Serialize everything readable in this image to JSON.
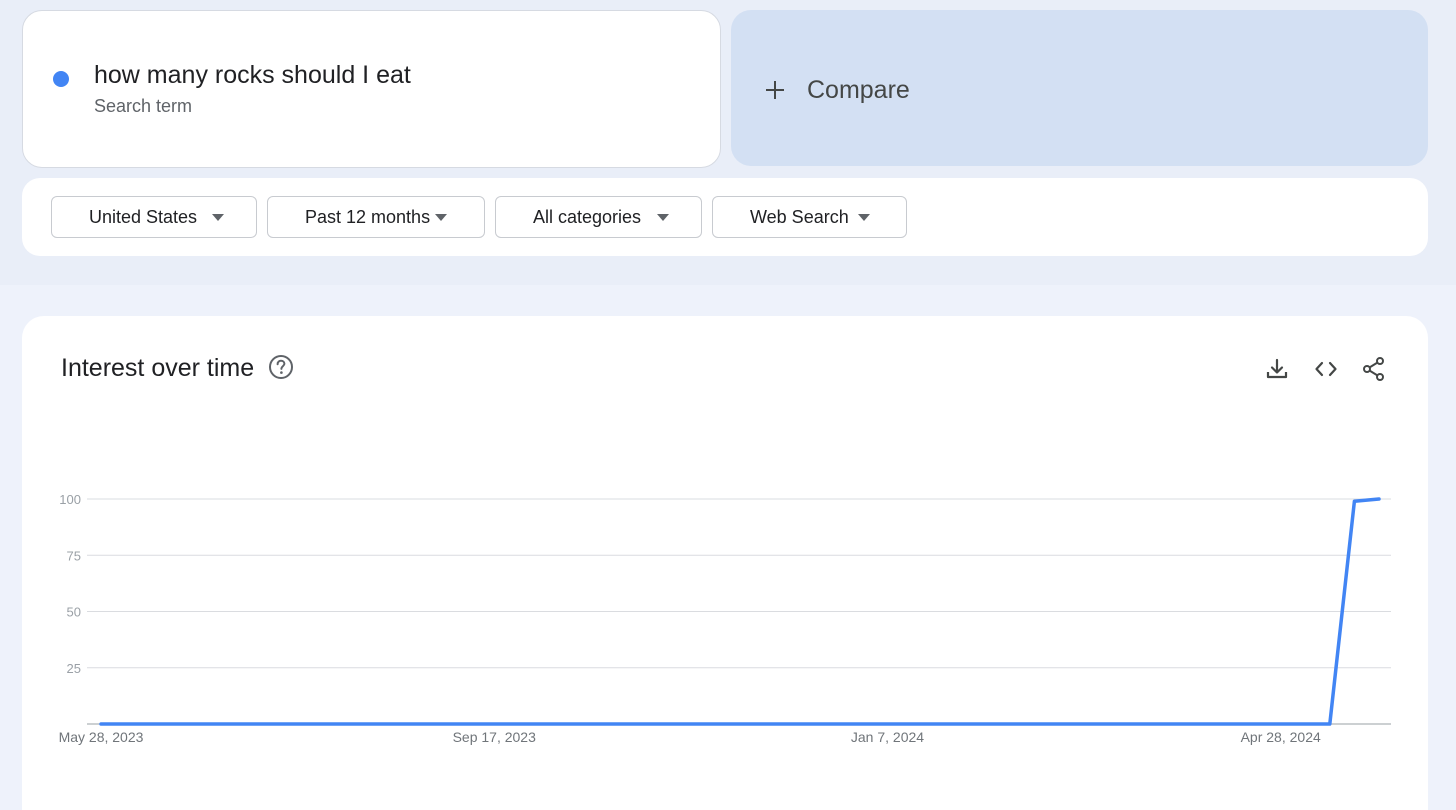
{
  "search_term": {
    "title": "how many rocks should I eat",
    "subtitle": "Search term",
    "color": "#4285f4"
  },
  "compare": {
    "label": "Compare"
  },
  "filters": {
    "region": "United States",
    "time_range": "Past 12 months",
    "category": "All categories",
    "property": "Web Search"
  },
  "interest_panel": {
    "title": "Interest over time",
    "icons": [
      "help-icon",
      "download-icon",
      "embed-code-icon",
      "share-icon"
    ]
  },
  "chart_data": {
    "type": "line",
    "title": "Interest over time",
    "xlabel": "",
    "ylabel": "",
    "ylim": [
      0,
      100
    ],
    "yticks": [
      25,
      50,
      75,
      100
    ],
    "xticks": [
      "May 28, 2023",
      "Sep 17, 2023",
      "Jan 7, 2024",
      "Apr 28, 2024"
    ],
    "x_start": "2023-05-28",
    "x_end": "2024-05-26",
    "grid": true,
    "series": [
      {
        "color": "#4285f4",
        "points": [
          {
            "x": "2023-05-28",
            "y": 0
          },
          {
            "x": "2024-05-12",
            "y": 0
          },
          {
            "x": "2024-05-19",
            "y": 99
          },
          {
            "x": "2024-05-26",
            "y": 100
          }
        ]
      }
    ]
  }
}
